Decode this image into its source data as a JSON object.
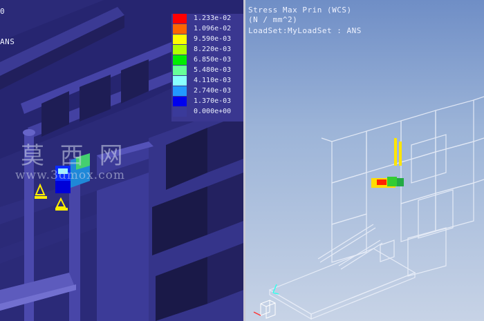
{
  "left_viewport": {
    "partial_label_top": "0",
    "partial_label_side": "ANS",
    "model": "3d-structure-stress-contour"
  },
  "legend": {
    "values": [
      "1.233e-02",
      "1.096e-02",
      "9.590e-03",
      "8.220e-03",
      "6.850e-03",
      "5.480e-03",
      "4.110e-03",
      "2.740e-03",
      "1.370e-03",
      "0.000e+00"
    ],
    "colors": [
      "#ff0000",
      "#ff6600",
      "#ffff00",
      "#b0ff00",
      "#00ee00",
      "#66ff99",
      "#88ffff",
      "#2299ff",
      "#0000ee",
      "#3a3a9a"
    ]
  },
  "watermark": {
    "title": "莫 西 网",
    "url": "www.3dmox.com"
  },
  "right_viewport": {
    "line1": "Stress Max Prin (WCS)",
    "line2": "(N / mm^2)",
    "line3": "LoadSet:MyLoadSet :  ANS",
    "model": "3d-wireframe-frame"
  },
  "colors": {
    "left_bg": "#2b2a78",
    "right_bg_top": "#6f8ec6",
    "right_bg_bottom": "#c7d3e6",
    "divider": "#c8c8d2"
  }
}
